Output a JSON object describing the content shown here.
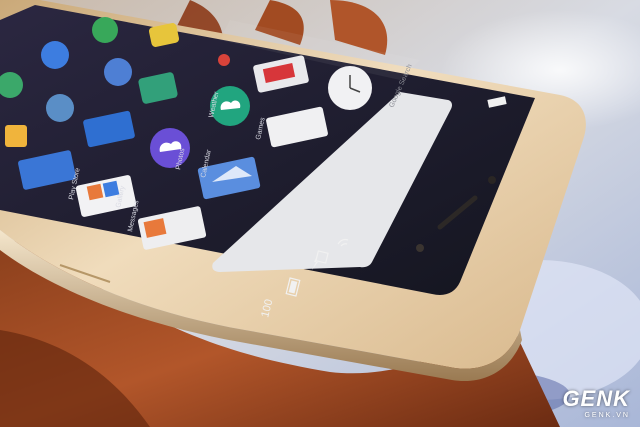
{
  "status_bar": {
    "battery_level": "100"
  },
  "search_bar": {
    "placeholder": "Google Search"
  },
  "app_labels": [
    "Gallery",
    "Photos",
    "Games",
    "Weather",
    "Calendar",
    "Play Store",
    "Messages"
  ],
  "watermark": {
    "brand": "GENK",
    "domain": "GENK.VN"
  },
  "colors": {
    "phone_gold": "#e3c9a1",
    "screen_dark": "#1b1c2c",
    "search_bar_bg": "#e6e7ea",
    "accent_orange": "#e8793b"
  },
  "icons": [
    "sun-icon",
    "cloud-icon",
    "gallery-icon",
    "play-store-icon",
    "calendar-icon",
    "messages-icon",
    "mail-icon",
    "clock-icon",
    "battery-icon",
    "signal-icon",
    "wifi-icon"
  ]
}
